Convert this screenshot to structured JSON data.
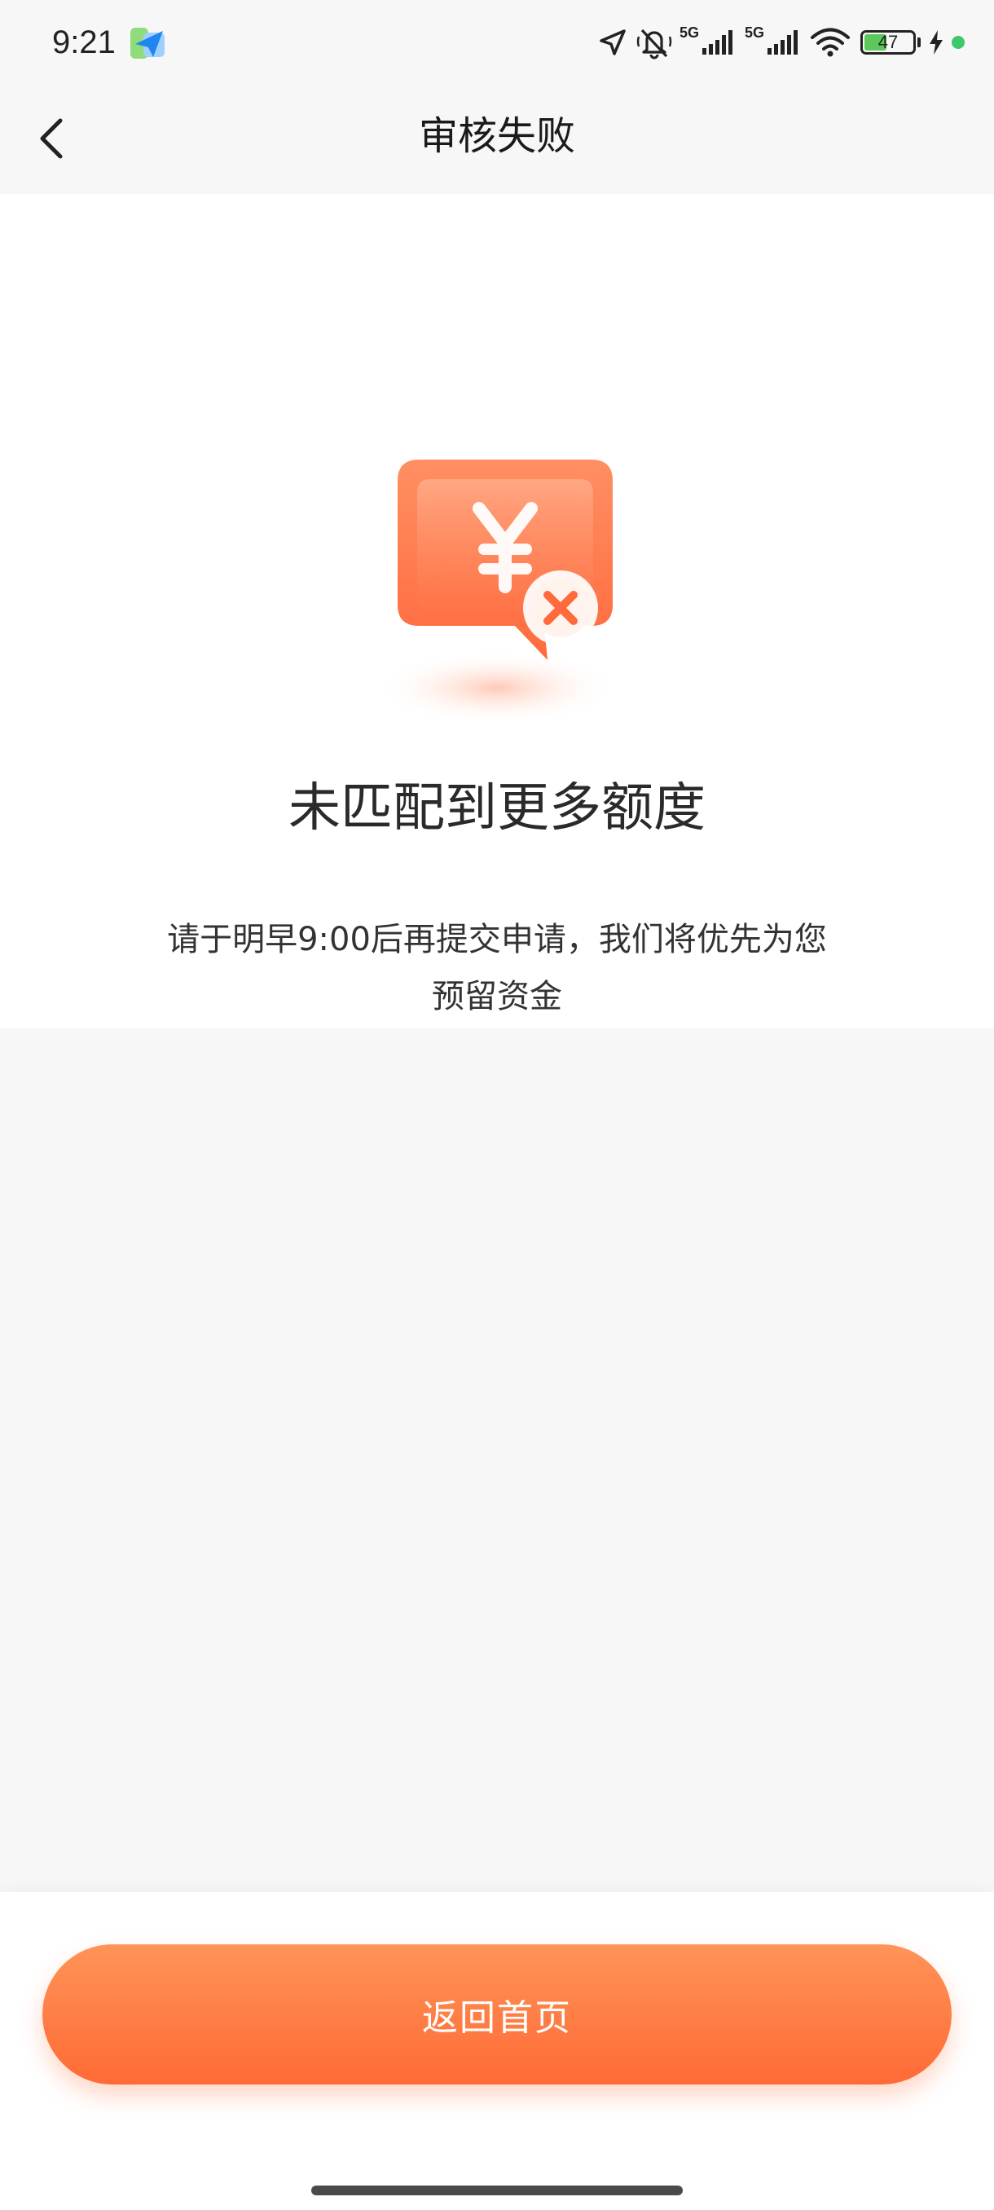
{
  "status_bar": {
    "time": "9:21",
    "network_1": "5G",
    "network_2": "5G",
    "battery_level": "47",
    "battery_fraction": 0.47,
    "icons": [
      "location-icon",
      "silent-icon",
      "signal-icon",
      "signal-icon",
      "wifi-icon",
      "battery-icon",
      "charging-icon"
    ],
    "dot_color": "#3cc86b"
  },
  "nav": {
    "title": "审核失败",
    "back_icon": "chevron-left-icon"
  },
  "result": {
    "icon": "yuan-rejected-icon",
    "title": "未匹配到更多额度",
    "description": "请于明早9:00后再提交申请，我们将优先为您预留资金"
  },
  "actions": {
    "home_button_label": "返回首页"
  },
  "colors": {
    "accent": "#ff6a35",
    "accent_light": "#ff9458",
    "background": "#f7f7f7",
    "card": "#ffffff"
  }
}
